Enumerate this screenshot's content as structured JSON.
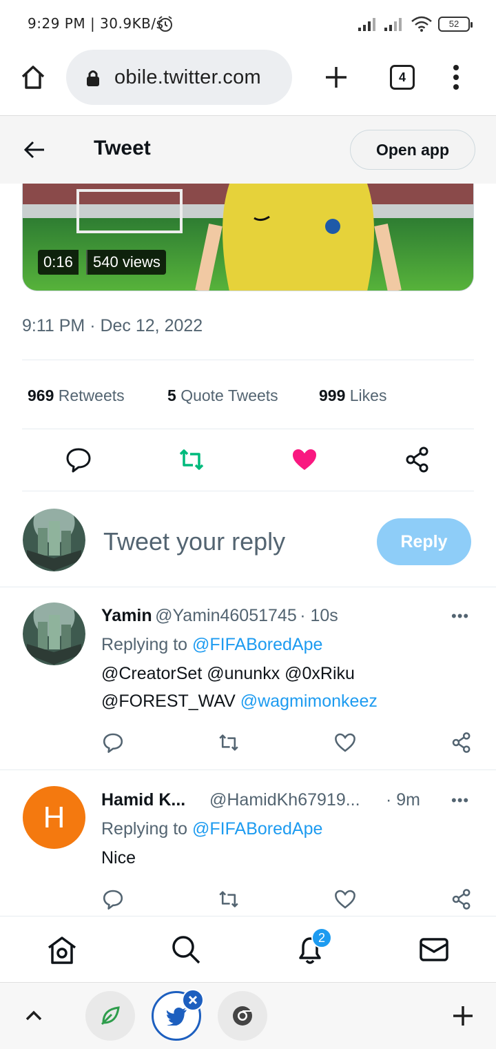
{
  "status_bar": {
    "time": "9:29 PM | 30.9KB/s",
    "battery": "52"
  },
  "browser": {
    "url": "obile.twitter.com",
    "tab_count": "4"
  },
  "header": {
    "title": "Tweet",
    "open_app": "Open app"
  },
  "video": {
    "duration": "0:16",
    "views": "540 views"
  },
  "tweet": {
    "timestamp": "9:11 PM · Dec 12, 2022",
    "stats": {
      "retweets_count": "969",
      "retweets_label": "Retweets",
      "quotes_count": "5",
      "quotes_label": "Quote Tweets",
      "likes_count": "999",
      "likes_label": "Likes"
    }
  },
  "compose": {
    "placeholder": "Tweet your reply",
    "reply_button": "Reply"
  },
  "replies": [
    {
      "name": "Yamin",
      "handle": "@Yamin46051745",
      "time": "· 10s",
      "replying_to_prefix": "Replying to ",
      "replying_to": "@FIFABoredApe",
      "mentions_line1": "@CreatorSet @ununkx @0xRiku",
      "mentions_line2_plain": "@FOREST_WAV",
      "mentions_line2_link": "@wagmimonkeez"
    },
    {
      "name": "Hamid K...",
      "handle": "@HamidKh67919...",
      "time": "· 9m",
      "avatar_letter": "H",
      "replying_to_prefix": "Replying to ",
      "replying_to": "@FIFABoredApe",
      "text": "Nice"
    }
  ],
  "bottom_nav": {
    "notifications_badge": "2"
  },
  "colors": {
    "twitter_blue": "#1d9bf0",
    "retweet_green": "#00ba7c",
    "like_pink": "#f91880",
    "reply_button_disabled": "#8ecdf8",
    "avatar_orange": "#f4790f"
  },
  "icons": [
    "home-icon",
    "lock-icon",
    "plus-icon",
    "tabs-icon",
    "more-vert-icon",
    "back-arrow-icon",
    "reply-icon",
    "retweet-icon",
    "like-icon",
    "share-icon",
    "search-icon",
    "bell-icon",
    "mail-icon",
    "chevron-up-icon",
    "bird-icon",
    "chrome-icon",
    "leaf-icon"
  ]
}
